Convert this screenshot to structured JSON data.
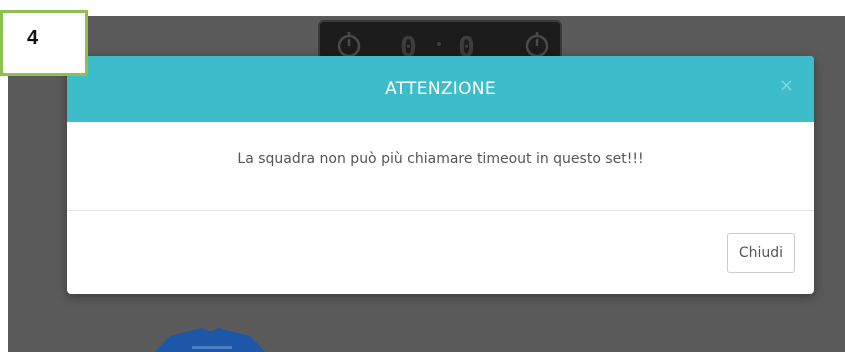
{
  "step_badge": {
    "label": "4"
  },
  "timer": {
    "left_digit": "0",
    "right_digit": "0",
    "left_icon": "stopwatch-icon",
    "right_icon": "stopwatch-icon"
  },
  "modal": {
    "title": "ATTENZIONE",
    "close_icon": "×",
    "message": "La squadra non può più chiamare timeout in questo set!!!",
    "close_button_label": "Chiudi"
  },
  "colors": {
    "header": "#3dbdca",
    "backdrop": "#5a5a5a",
    "badge_border": "#8cc152",
    "jersey": "#1f57a8"
  }
}
